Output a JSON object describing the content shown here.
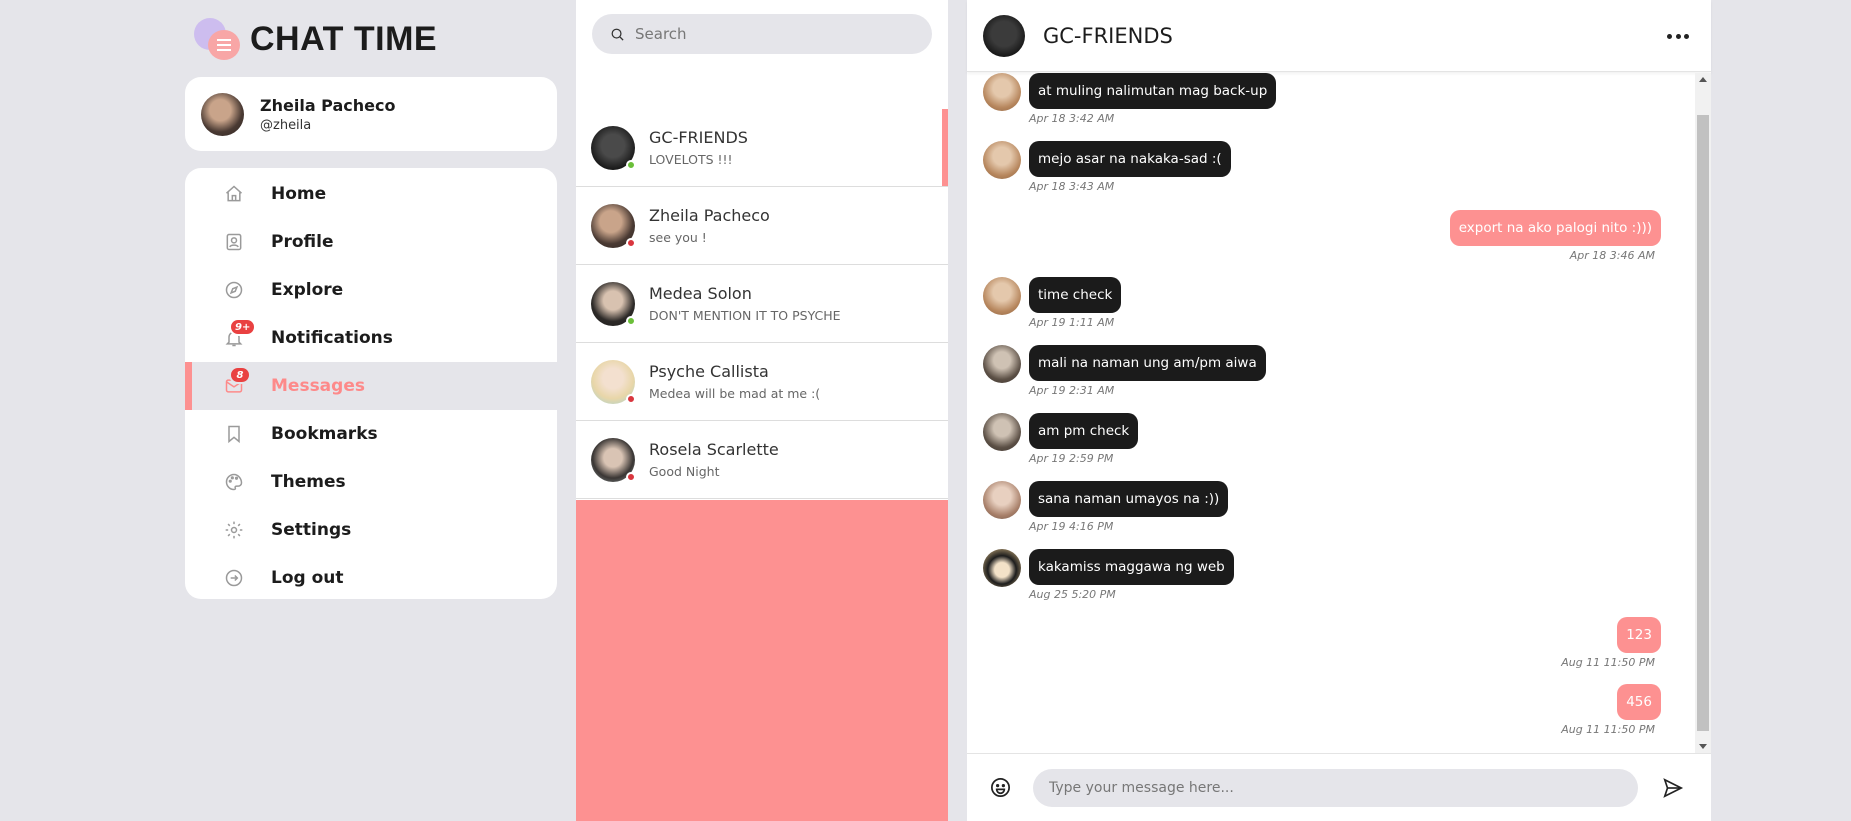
{
  "app": {
    "title": "CHAT TIME"
  },
  "user": {
    "name": "Zheila Pacheco",
    "handle": "@zheila"
  },
  "nav": {
    "items": [
      {
        "label": "Home",
        "icon": "home-icon"
      },
      {
        "label": "Profile",
        "icon": "profile-icon"
      },
      {
        "label": "Explore",
        "icon": "compass-icon"
      },
      {
        "label": "Notifications",
        "icon": "bell-icon",
        "badge": "9+"
      },
      {
        "label": "Messages",
        "icon": "mail-icon",
        "badge": "8",
        "active": true
      },
      {
        "label": "Bookmarks",
        "icon": "bookmark-icon"
      },
      {
        "label": "Themes",
        "icon": "palette-icon"
      },
      {
        "label": "Settings",
        "icon": "gear-icon"
      },
      {
        "label": "Log out",
        "icon": "logout-icon"
      }
    ]
  },
  "search": {
    "placeholder": "Search"
  },
  "conversations": [
    {
      "name": "GC-FRIENDS",
      "preview": "LOVELOTS !!!",
      "status": "online",
      "active": true
    },
    {
      "name": "Zheila Pacheco",
      "preview": "see you !",
      "status": "offline"
    },
    {
      "name": "Medea Solon",
      "preview": "DON'T MENTION IT TO PSYCHE",
      "status": "online"
    },
    {
      "name": "Psyche Callista",
      "preview": "Medea will be mad at me :(",
      "status": "offline"
    },
    {
      "name": "Rosela Scarlette",
      "preview": "Good Night",
      "status": "offline"
    }
  ],
  "chat": {
    "title": "GC-FRIENDS",
    "messages": [
      {
        "text": "at muling nalimutan mag back-up",
        "time": "Apr 18 3:42 AM",
        "mine": false,
        "sender": "a"
      },
      {
        "text": "mejo asar na nakaka-sad :(",
        "time": "Apr 18 3:43 AM",
        "mine": false,
        "sender": "a"
      },
      {
        "text": "export na ako palogi nito :)))",
        "time": "Apr 18 3:46 AM",
        "mine": true
      },
      {
        "text": "time check",
        "time": "Apr 19 1:11 AM",
        "mine": false,
        "sender": "a"
      },
      {
        "text": "mali na naman ung am/pm aiwa",
        "time": "Apr 19 2:31 AM",
        "mine": false,
        "sender": "b"
      },
      {
        "text": "am pm check",
        "time": "Apr 19 2:59 PM",
        "mine": false,
        "sender": "b"
      },
      {
        "text": "sana naman umayos na :))",
        "time": "Apr 19 4:16 PM",
        "mine": false,
        "sender": "c"
      },
      {
        "text": "kakamiss maggawa ng web",
        "time": "Aug 25 5:20 PM",
        "mine": false,
        "sender": "d"
      },
      {
        "text": "123",
        "time": "Aug 11 11:50 PM",
        "mine": true
      },
      {
        "text": "456",
        "time": "Aug 11 11:50 PM",
        "mine": true
      }
    ]
  },
  "composer": {
    "placeholder": "Type your message here..."
  },
  "colors": {
    "accent": "#fd9191",
    "dark_bubble": "#1b1b1b",
    "page_background": "#e5e5ea",
    "badge": "#e94141",
    "status_online": "#6bbf3a",
    "status_offline": "#d9363e"
  }
}
